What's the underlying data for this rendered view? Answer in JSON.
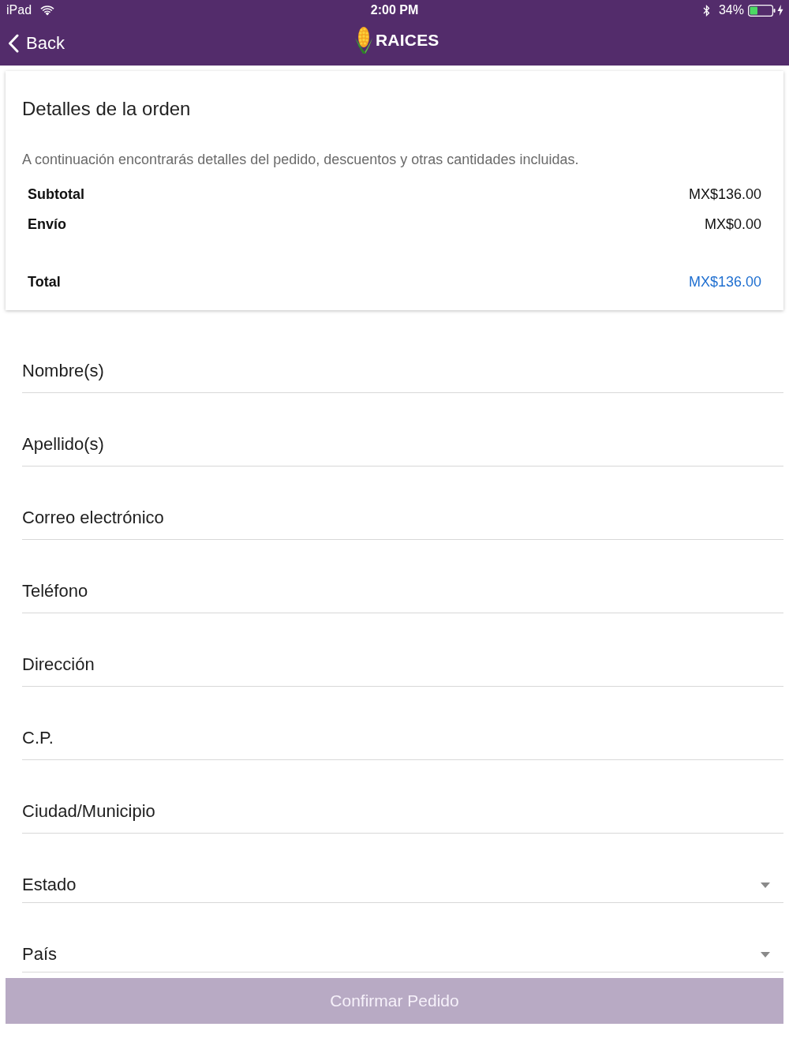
{
  "status_bar": {
    "device": "iPad",
    "time": "2:00 PM",
    "battery": "34%"
  },
  "nav_bar": {
    "back_label": "Back",
    "logo_text": "RAICES"
  },
  "order_card": {
    "title": "Detalles de la orden",
    "description": "A continuación encontrarás detalles del pedido, descuentos y otras cantidades incluidas.",
    "rows": [
      {
        "kind": "line",
        "label": "Subtotal",
        "value": "MX$136.00"
      },
      {
        "kind": "line",
        "label": "Envío",
        "value": "MX$0.00"
      },
      {
        "kind": "total",
        "label": "Total",
        "value": "MX$136.00"
      }
    ]
  },
  "form": {
    "fields": [
      {
        "kind": "text",
        "placeholder": "Nombre(s)"
      },
      {
        "kind": "text",
        "placeholder": "Apellido(s)"
      },
      {
        "kind": "text",
        "placeholder": "Correo electrónico"
      },
      {
        "kind": "text",
        "placeholder": "Teléfono"
      },
      {
        "kind": "text",
        "placeholder": "Dirección"
      },
      {
        "kind": "text",
        "placeholder": "C.P."
      },
      {
        "kind": "text",
        "placeholder": "Ciudad/Municipio"
      },
      {
        "kind": "select",
        "placeholder": "Estado"
      },
      {
        "kind": "select",
        "placeholder": "País"
      }
    ]
  },
  "confirm_button": {
    "label": "Confirmar Pedido",
    "disabled": true
  }
}
